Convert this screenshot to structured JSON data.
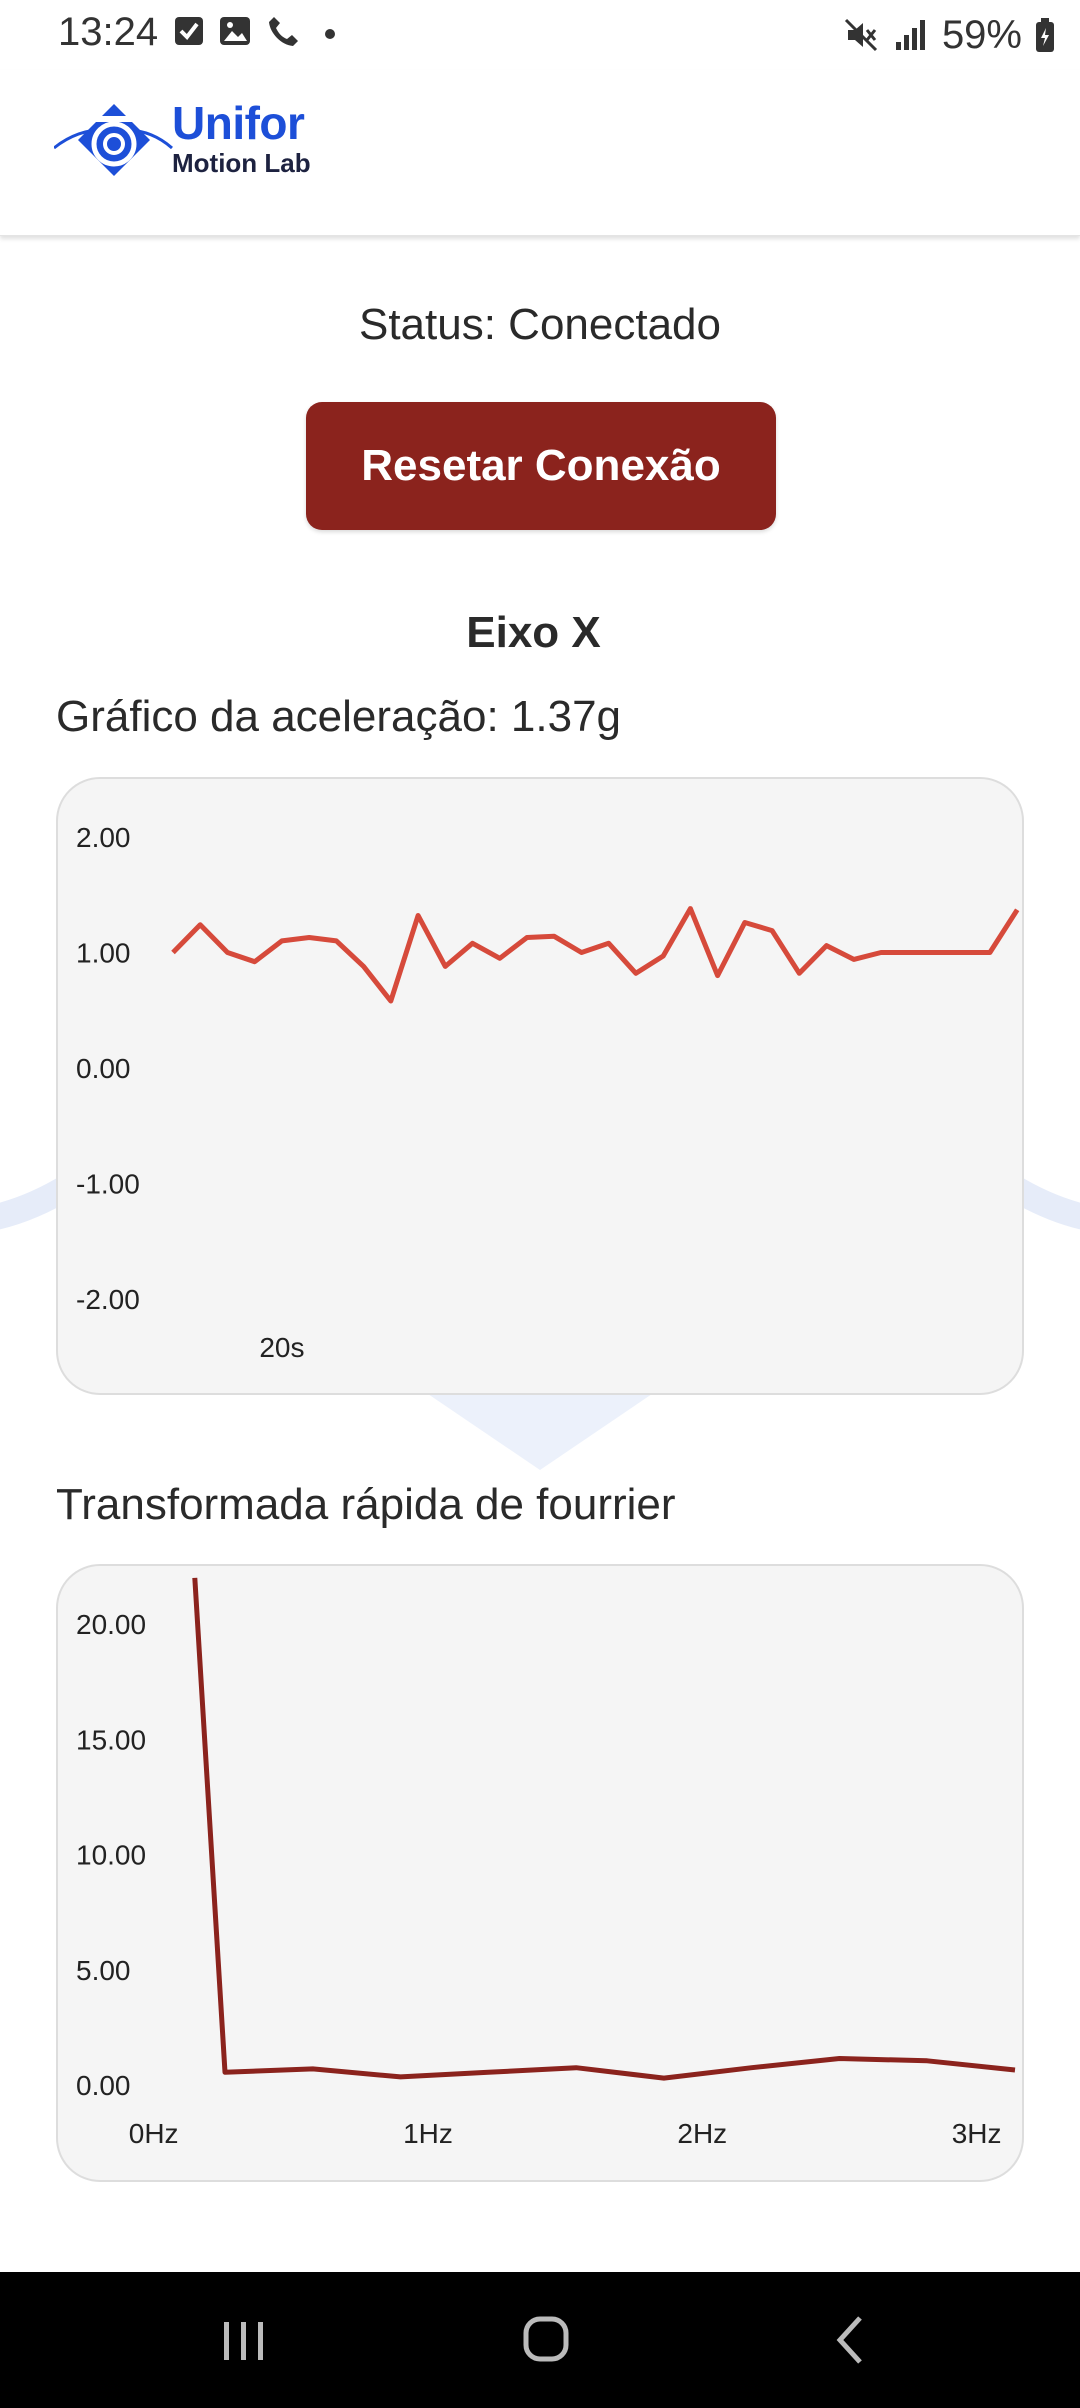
{
  "status_bar": {
    "time": "13:24",
    "battery": "59%",
    "left_icons": [
      "check-box-icon",
      "gallery-icon",
      "phone-icon",
      "dot-icon"
    ],
    "right_icons": [
      "mute-icon",
      "signal-icon",
      "battery-icon"
    ]
  },
  "header": {
    "logo_line1": "Unifor",
    "logo_line2": "Motion Lab",
    "brand_color": "#1d4fd8"
  },
  "main": {
    "status": "Status: Conectado",
    "reset_button": "Resetar Conexão",
    "axis_title": "Eixo X",
    "accel_label": "Gráfico da aceleração: 1.37g",
    "fft_label": "Transformada rápida de fourrier",
    "accent_color": "#8b231d",
    "line_color": "#d64a3b"
  },
  "chart_data": [
    {
      "type": "line",
      "title": "",
      "y_ticks": [
        "2.00",
        "1.00",
        "0.00",
        "-1.00",
        "-2.00"
      ],
      "x_ticks": [
        {
          "label": "20s",
          "x": 20
        }
      ],
      "ylim": [
        -2,
        2
      ],
      "xlim": [
        16,
        48.5
      ],
      "grid": false,
      "series": [
        {
          "color": "#d64a3b",
          "x": [
            16,
            17,
            18,
            19,
            20,
            21,
            22,
            23,
            24,
            25,
            26,
            27,
            28,
            29,
            30,
            31,
            32,
            33,
            34,
            35,
            36,
            37,
            38,
            39,
            40,
            41,
            42,
            43,
            44,
            45,
            46,
            47
          ],
          "values": [
            1.0,
            1.24,
            1.0,
            0.92,
            1.1,
            1.13,
            1.1,
            0.88,
            0.58,
            1.32,
            0.88,
            1.08,
            0.95,
            1.13,
            1.14,
            1.0,
            1.08,
            0.82,
            0.97,
            1.38,
            0.8,
            1.26,
            1.19,
            0.82,
            1.06,
            0.94,
            1.0,
            1.0,
            1.0,
            1.0,
            1.0,
            1.37
          ]
        }
      ]
    },
    {
      "type": "line",
      "title": "",
      "y_ticks": [
        "20.00",
        "15.00",
        "10.00",
        "5.00",
        "0.00"
      ],
      "x_ticks": [
        {
          "label": "0Hz",
          "x": 0
        },
        {
          "label": "1Hz",
          "x": 1
        },
        {
          "label": "2Hz",
          "x": 2
        },
        {
          "label": "3Hz",
          "x": 3
        }
      ],
      "ylim": [
        0,
        20
      ],
      "xlim": [
        -0.13,
        3.18
      ],
      "grid": false,
      "series": [
        {
          "color": "#8b231d",
          "x": [
            0.15,
            0.26,
            0.58,
            0.9,
            1.22,
            1.54,
            1.86,
            2.18,
            2.5,
            2.82,
            3.14
          ],
          "values": [
            22.0,
            0.55,
            0.7,
            0.35,
            0.55,
            0.75,
            0.3,
            0.75,
            1.15,
            1.05,
            0.65
          ]
        }
      ]
    }
  ]
}
